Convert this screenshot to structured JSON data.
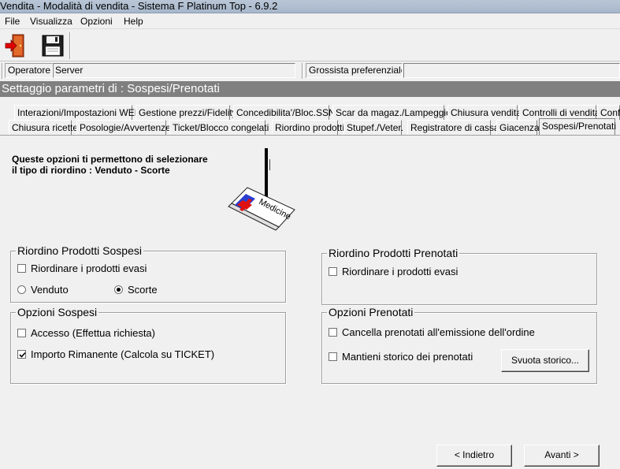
{
  "window": {
    "title": "Vendita - Modalità di vendita - Sistema F Platinum Top - 6.9.2"
  },
  "menu": [
    "File",
    "Visualizza",
    "Opzioni",
    "Help"
  ],
  "toolbar": {
    "exit_icon": "exit-door-icon",
    "save_icon": "floppy-disk-icon"
  },
  "infobar": {
    "operatore_label": "Operatore",
    "operatore_value": "Server",
    "grossista_label": "Grossista preferenziale",
    "grossista_value": ""
  },
  "section_title": "Settaggio parametri di : Sospesi/Prenotati",
  "tabs_row1": [
    "Interazioni/Impostazioni WEB",
    "Gestione prezzi/Fidelity",
    "Concedibilita'/Bloc.SSN",
    "Scar da magaz./Lampeggio",
    "Chiusura vendita",
    "Controlli di vendita",
    "Confi"
  ],
  "tabs_row2": [
    "Chiusura ricette",
    "Posologie/Avvertenze",
    "Ticket/Blocco congelati",
    "Riordino prodotti",
    "Stupef./Veter.",
    "Registratore di cassa",
    "Giacenza",
    "Sospesi/Prenotati"
  ],
  "active_tab": "Sospesi/Prenotati",
  "description": {
    "line1": "Queste opzioni ti permettono di selezionare",
    "line2": "il tipo di riordino :  Venduto - Scorte"
  },
  "illustration": {
    "box_text": "Medicine",
    "icon": "medicine-box-icon"
  },
  "riordino_sospesi": {
    "title": "Riordino Prodotti Sospesi",
    "evasi_label": "Riordinare i prodotti evasi",
    "evasi_checked": false,
    "venduto_label": "Venduto",
    "scorte_label": "Scorte",
    "selected": "Scorte"
  },
  "riordino_prenotati": {
    "title": "Riordino Prodotti Prenotati",
    "evasi_label": "Riordinare i prodotti evasi",
    "evasi_checked": false
  },
  "opzioni_sospesi": {
    "title": "Opzioni Sospesi",
    "accesso_label": "Accesso (Effettua richiesta)",
    "accesso_checked": false,
    "importo_label": "Importo Rimanente  (Calcola su TICKET)",
    "importo_checked": true
  },
  "opzioni_prenotati": {
    "title": "Opzioni Prenotati",
    "cancella_label": "Cancella prenotati all'emissione dell'ordine",
    "cancella_checked": false,
    "storico_label": "Mantieni storico dei prenotati",
    "storico_checked": false,
    "svuota_label": "Svuota storico..."
  },
  "nav": {
    "back_label": "< Indietro",
    "next_label": "Avanti >"
  }
}
